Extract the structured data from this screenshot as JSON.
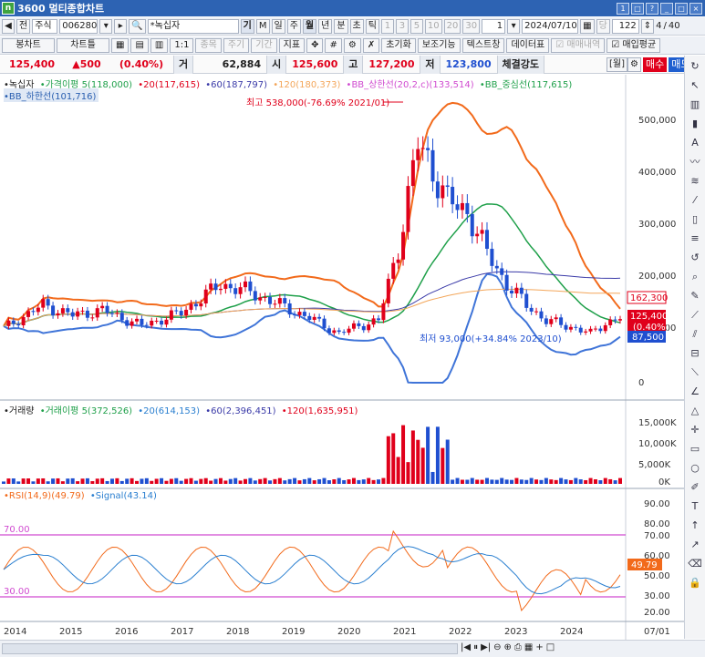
{
  "window": {
    "title": "3600 멀티종합차트",
    "icon_letter": "n"
  },
  "toolbar1": {
    "tab1": "전",
    "market": "주식",
    "code": "006280",
    "name": "*녹십자",
    "btns": [
      "기",
      "M",
      "일",
      "주",
      "월",
      "년",
      "분",
      "초",
      "틱"
    ],
    "nums": [
      "1",
      "3",
      "5",
      "10",
      "20",
      "30"
    ],
    "interval_value": "1",
    "date": "2024/07/10",
    "dang": "당",
    "count": "122",
    "page_a": "4",
    "page_b": "40"
  },
  "toolbar2": {
    "items": [
      "봉차트",
      "차트틀",
      "종목",
      "주기",
      "기간",
      "지표",
      "초기화",
      "보조기능",
      "텍스트창",
      "데이터표",
      "매매내역",
      "매입평균"
    ]
  },
  "pricebar": {
    "price": "125,400",
    "change": "▲500",
    "rate": "(0.40%)",
    "vol_label": "거",
    "volume": "62,884",
    "open_label": "시",
    "open": "125,600",
    "high_label": "고",
    "high": "127,200",
    "low_label": "저",
    "low": "123,800",
    "strength_label": "체결강도",
    "period": "[월]",
    "buy": "매수",
    "sell": "매도"
  },
  "price_panel": {
    "legend": [
      "•녹십자",
      "•가격이평 5(118,000)",
      "•20(117,615)",
      "•60(187,797)",
      "•120(180,373)",
      "•BB_상한선(20,2,c)(133,514)",
      "•BB_중심선(117,615)"
    ],
    "legend2": "•BB_하한선(101,716)",
    "high_note": "최고 538,000(-76.69% 2021/01)",
    "low_note": "최저 93,000(+34.84% 2023/10)",
    "yaxis": [
      "500,000",
      "400,000",
      "300,000",
      "200,000",
      "100,000",
      "0"
    ],
    "tag_bb_upper": "162,300",
    "tag_price": "125,400",
    "tag_rate": "(0.40%)",
    "tag_bb_lower": "87,500"
  },
  "volume_panel": {
    "legend": [
      "•거래량",
      "•거래이평 5(372,526)",
      "•20(614,153)",
      "•60(2,396,451)",
      "•120(1,635,951)"
    ],
    "yaxis": [
      "15,000K",
      "10,000K",
      "5,000K",
      "0K"
    ]
  },
  "rsi_panel": {
    "legend": [
      "•RSI(14,9)(49.79)",
      "•Signal(43.14)"
    ],
    "level_high": "70.00",
    "level_low": "30.00",
    "yaxis": [
      "90.00",
      "80.00",
      "70.00",
      "60.00",
      "50.00",
      "40.00",
      "30.00",
      "20.00",
      "10.00"
    ],
    "tag": "49.79"
  },
  "xaxis": [
    "2014",
    "2015",
    "2016",
    "2017",
    "2018",
    "2019",
    "2020",
    "2021",
    "2022",
    "2023",
    "2024"
  ],
  "xaxis_end": "07/01",
  "colors": {
    "up": "#e0001b",
    "down": "#1f4fd0",
    "bb": "#f26a1b",
    "ma20": "#1fa04a",
    "ma60": "#3a3aa8",
    "ma120": "#f3a65a"
  }
}
